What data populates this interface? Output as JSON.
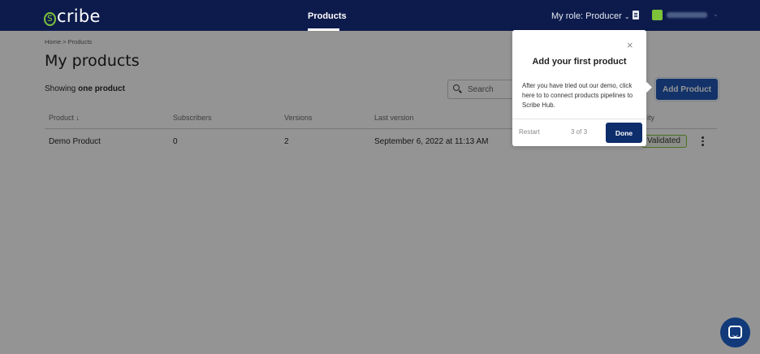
{
  "header": {
    "logo_text": "cribe",
    "logo_letter": "s",
    "nav_products": "Products",
    "role_label": "My role: Producer",
    "role_chevron": "⌄",
    "user_chevron": "⌄",
    "brand_color": "#0d1b4c",
    "accent_color": "#7dc33a"
  },
  "breadcrumb": "Home > Products",
  "page_title": "My products",
  "summary": {
    "prefix": "Showing ",
    "count_text": "one product"
  },
  "search": {
    "placeholder": "Search"
  },
  "add_button_label": "Add Product",
  "table": {
    "headers": [
      "Product ↓",
      "Subscribers",
      "Versions",
      "Last version",
      "ity"
    ],
    "rows": [
      {
        "product": "Demo Product",
        "subscribers": "0",
        "versions": "2",
        "last_version": "September 6, 2022 at 11:13 AM",
        "status": "Validated"
      }
    ]
  },
  "tour": {
    "close_glyph": "×",
    "title": "Add your first product",
    "body": "After you have tried out our demo, click here to to connect products pipelines to Scribe Hub.",
    "restart_label": "Restart",
    "step_text": "3 of 3",
    "done_label": "Done"
  },
  "icons": {
    "search": "search-icon",
    "docs": "document-icon",
    "chat": "chat-icon",
    "kebab": "more-vertical-icon",
    "close": "close-icon"
  }
}
